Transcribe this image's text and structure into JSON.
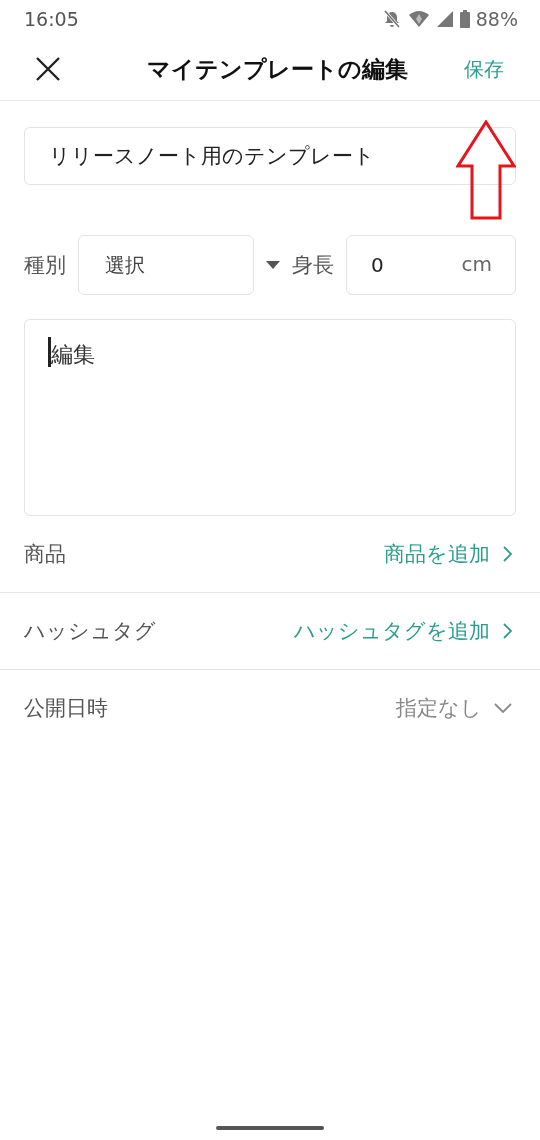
{
  "status_bar": {
    "time": "16:05",
    "battery": "88%"
  },
  "header": {
    "title": "マイテンプレートの編集",
    "save": "保存"
  },
  "template_name": {
    "value": "リリースノート用のテンプレート"
  },
  "type": {
    "label": "種別",
    "value": "選択"
  },
  "height": {
    "label": "身長",
    "value": "0",
    "unit": "cm"
  },
  "body": {
    "placeholder": "編集"
  },
  "rows": [
    {
      "label": "商品",
      "action": "商品を追加",
      "kind": "link"
    },
    {
      "label": "ハッシュタグ",
      "action": "ハッシュタグを追加",
      "kind": "link"
    },
    {
      "label": "公開日時",
      "action": "指定なし",
      "kind": "dropdown"
    }
  ]
}
